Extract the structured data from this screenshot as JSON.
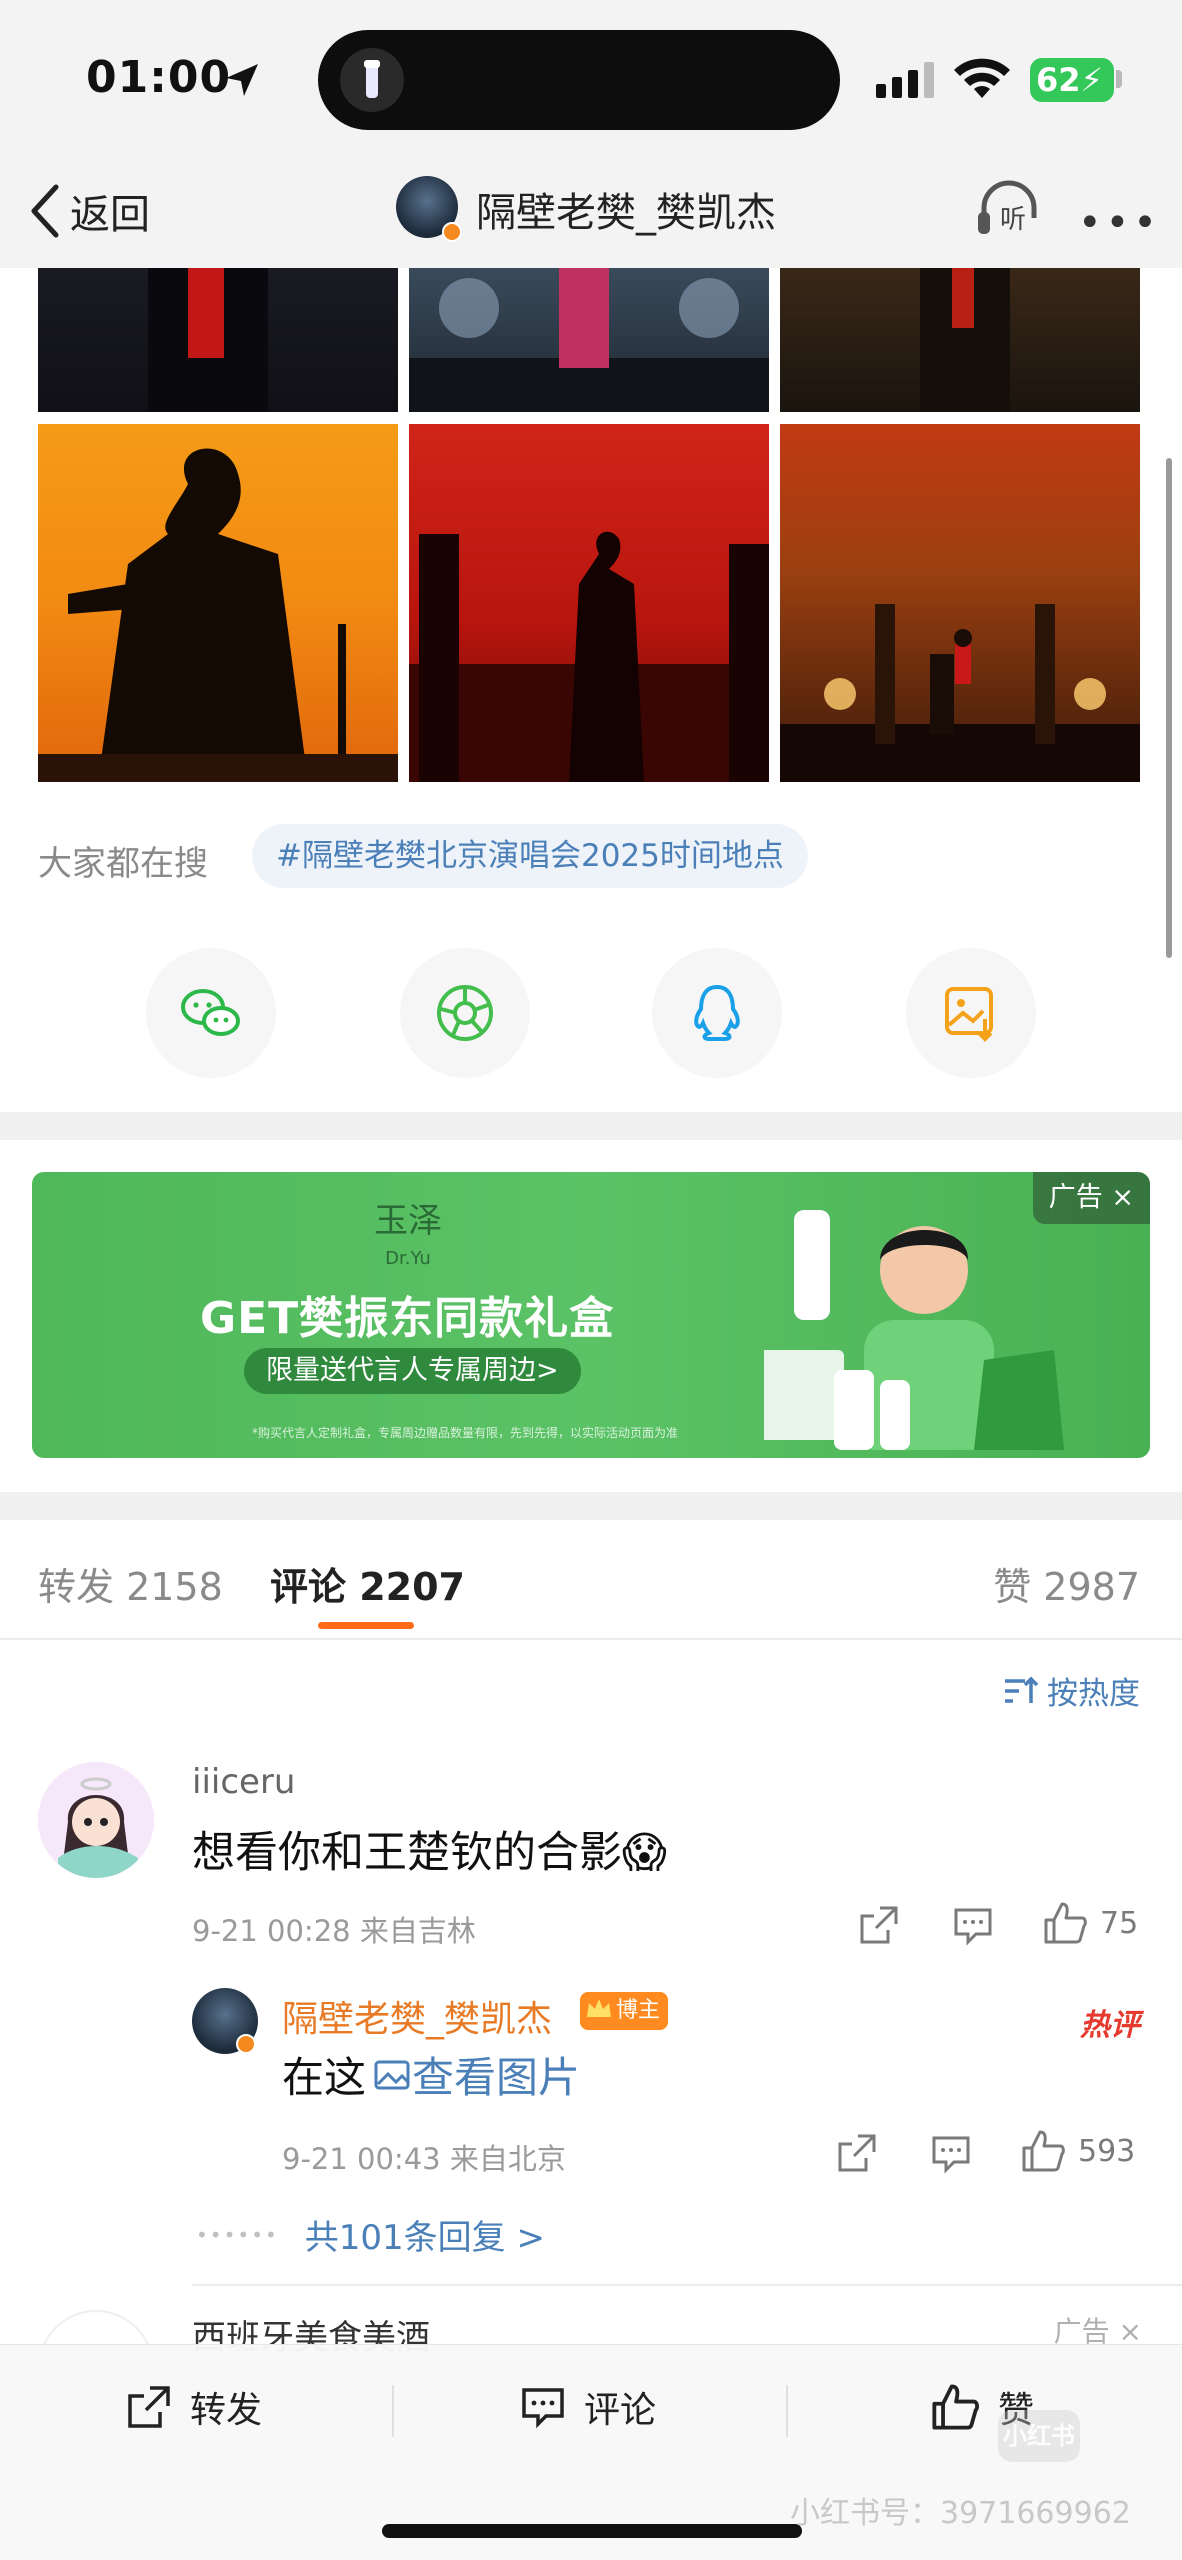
{
  "status_bar": {
    "time": "01:00",
    "battery": "62"
  },
  "nav": {
    "back_label": "返回",
    "title": "隔壁老樊_樊凯杰",
    "listen_label": "听"
  },
  "search": {
    "label": "大家都在搜",
    "tag": "#隔壁老樊北京演唱会2025时间地点"
  },
  "share": [
    "wechat-icon",
    "moments-icon",
    "qq-icon",
    "save-image-icon"
  ],
  "ad": {
    "brand": "玉泽",
    "brand_en": "Dr.Yu",
    "headline": "GET樊振东同款礼盒",
    "subline": "限量送代言人专属周边>",
    "badge": "广告 ×",
    "fine_print": "*购买代言人定制礼盒，专属周边赠品数量有限，先到先得，以实际活动页面为准"
  },
  "tabs": {
    "repost": "转发 2158",
    "comment": "评论 2207",
    "like": "赞 2987"
  },
  "sort_label": "按热度",
  "comment": {
    "user": "iiiceru",
    "text": "想看你和王楚钦的合影😱",
    "meta": "9-21 00:28  来自吉林",
    "likes": "75"
  },
  "reply": {
    "user": "隔壁老樊_樊凯杰",
    "badge": "博主",
    "hot_label": "热评",
    "text": "在这",
    "link": "查看图片",
    "meta": "9-21 00:43  来自北京",
    "likes": "593",
    "more": "共101条回复 >"
  },
  "next_comment": {
    "user": "西班牙美食美酒",
    "ad_label": "广告 ×"
  },
  "bottom_bar": {
    "repost": "转发",
    "comment": "评论",
    "like": "赞"
  },
  "watermark": {
    "logo": "小红书",
    "text": "小红书号：3971669962"
  },
  "colors": {
    "accent": "#ff6a1a",
    "link": "#4a7fb8",
    "blogger_name": "#e87a25",
    "hot": "#e63a2f"
  }
}
